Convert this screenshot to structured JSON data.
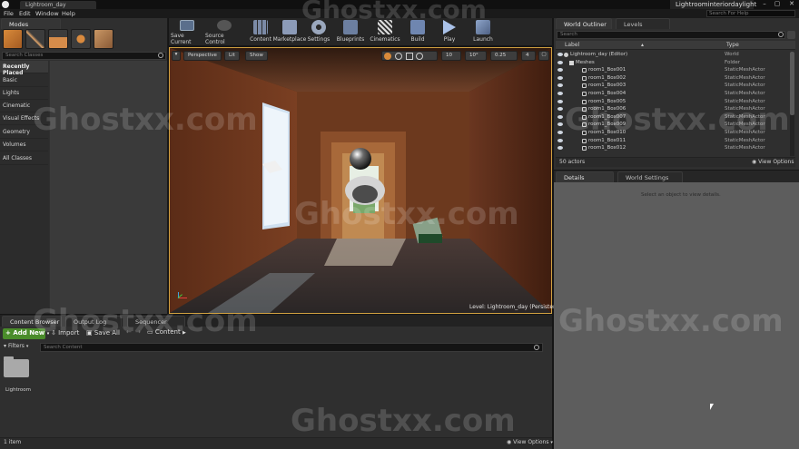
{
  "window": {
    "tab_title": "Lightroom_day",
    "project_name": "Lightroominteriordaylight",
    "help_search_placeholder": "Search For Help"
  },
  "menu": [
    "File",
    "Edit",
    "Window",
    "Help"
  ],
  "modes": {
    "tab": "Modes",
    "search_placeholder": "Search Classes",
    "categories": [
      "Recently Placed",
      "Basic",
      "Lights",
      "Cinematic",
      "Visual Effects",
      "Geometry",
      "Volumes",
      "All Classes"
    ]
  },
  "toolbar": {
    "buttons": [
      "Save Current",
      "Source Control",
      "Content",
      "Marketplace",
      "Settings",
      "Blueprints",
      "Cinematics",
      "Build",
      "Play",
      "Launch"
    ]
  },
  "viewport": {
    "perspective_label": "Perspective",
    "lit_label": "Lit",
    "show_label": "Show",
    "grid_snap": "10",
    "rot_snap": "10°",
    "scale_snap": "0.25",
    "cam_speed": "4",
    "level_label": "Level:",
    "level_name": "Lightroom_day (Persistent)"
  },
  "outliner": {
    "tab": "World Outliner",
    "tab2": "Levels",
    "search_placeholder": "Search",
    "col_label": "Label",
    "col_type": "Type",
    "rows": [
      {
        "label": "Lightroom_day (Editor)",
        "type": "World"
      },
      {
        "label": "Meshes",
        "type": "Folder"
      },
      {
        "label": "room1_Box001",
        "type": "StaticMeshActor"
      },
      {
        "label": "room1_Box002",
        "type": "StaticMeshActor"
      },
      {
        "label": "room1_Box003",
        "type": "StaticMeshActor"
      },
      {
        "label": "room1_Box004",
        "type": "StaticMeshActor"
      },
      {
        "label": "room1_Box005",
        "type": "StaticMeshActor"
      },
      {
        "label": "room1_Box006",
        "type": "StaticMeshActor"
      },
      {
        "label": "room1_Box007",
        "type": "StaticMeshActor"
      },
      {
        "label": "room1_Box009",
        "type": "StaticMeshActor"
      },
      {
        "label": "room1_Box010",
        "type": "StaticMeshActor"
      },
      {
        "label": "room1_Box011",
        "type": "StaticMeshActor"
      },
      {
        "label": "room1_Box012",
        "type": "StaticMeshActor"
      }
    ],
    "actor_count": "50 actors",
    "view_options": "View Options"
  },
  "details": {
    "tab": "Details",
    "tab2": "World Settings",
    "empty_message": "Select an object to view details."
  },
  "content_browser": {
    "tabs": [
      "Content Browser",
      "Output Log",
      "Sequencer"
    ],
    "add_new": "Add New",
    "import": "Import",
    "save_all": "Save All",
    "path_root": "Content",
    "filters": "Filters",
    "search_placeholder": "Search Content",
    "folder_name": "Lightroom",
    "item_count": "1 item",
    "view_options": "View Options"
  },
  "watermark": "Ghostxx.com",
  "colors": {
    "accent_green": "#4a8c2a",
    "selection_blue": "#2a4a6c",
    "panel_bg": "#2f2f2f"
  }
}
